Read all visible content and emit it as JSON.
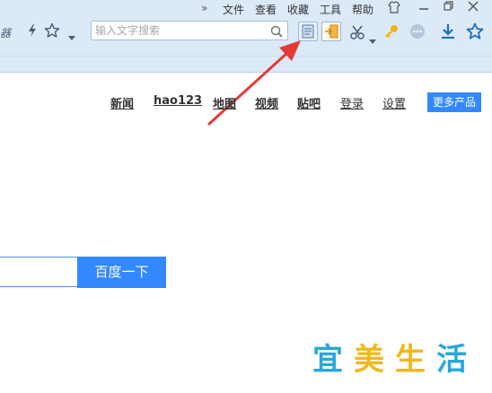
{
  "menubar": {
    "more": "»",
    "items": [
      "文件",
      "查看",
      "收藏",
      "工具",
      "帮助"
    ]
  },
  "toolbar": {
    "browser_label": "器",
    "search_placeholder": "输入文字搜索"
  },
  "nav": {
    "links": [
      "新闻",
      "hao123",
      "地图",
      "视频",
      "贴吧",
      "登录",
      "设置"
    ],
    "more_products": "更多产品"
  },
  "search": {
    "button_label": "百度一下"
  },
  "watermark": {
    "chars": [
      "宜",
      "美",
      "生",
      "活"
    ]
  },
  "colors": {
    "accent": "#3388ff",
    "chrome_bg": "#dce9f7",
    "arrow": "#e23b33"
  }
}
